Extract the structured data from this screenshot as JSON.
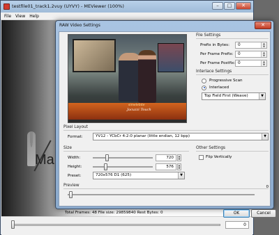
{
  "main_window": {
    "title": "testfile01_track1.2vuy (UYVY) - MEViewer (100%)",
    "menu": [
      "File",
      "View",
      "Help"
    ],
    "controls": {
      "minimize": "–",
      "maximize": "□",
      "close": "✕"
    },
    "video_text": "Ma",
    "position_value": "0"
  },
  "dialog": {
    "title": "RAW Video Settings",
    "close_label": "✕",
    "preview_banner": {
      "line1": "simelebite",
      "line2": "Jacuzzi Touch"
    },
    "file_settings": {
      "heading": "File Settings",
      "prefix_label": "Prefix in Bytes:",
      "prefix_value": "0",
      "per_frame_prefix_label": "Per Frame Prefix:",
      "per_frame_prefix_value": "0",
      "per_frame_postfix_label": "Per Frame Postfix:",
      "per_frame_postfix_value": "0"
    },
    "interlace": {
      "heading": "Interlace Settings",
      "progressive_label": "Progressive Scan",
      "interlaced_label": "Interlaced",
      "field_order": "Top Field First (Weave)"
    },
    "pixel_layout": {
      "heading": "Pixel Layout",
      "format_label": "Format:",
      "format_value": "YV12 - YCbCr 4:2:0 planar (little endian, 12 bpp)"
    },
    "size": {
      "heading": "Size",
      "width_label": "Width:",
      "width_value": "720",
      "height_label": "Height:",
      "height_value": "576",
      "preset_label": "Preset:",
      "preset_value": "720x576 D1 (625)"
    },
    "other": {
      "heading": "Other Settings",
      "flip_label": "Flip Vertically"
    },
    "preview": {
      "heading": "Preview",
      "value": "0"
    },
    "status": "Total Frames: 48   File size: 29859840   Rest Bytes: 0",
    "ok_label": "OK",
    "cancel_label": "Cancel"
  }
}
